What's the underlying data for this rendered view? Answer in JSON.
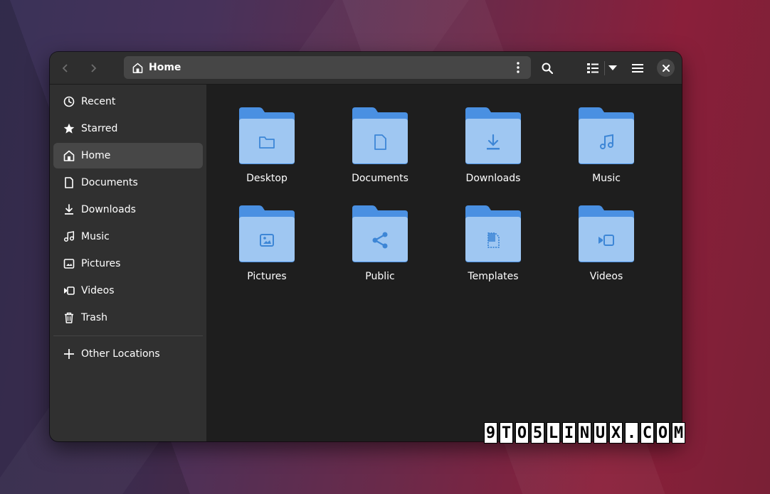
{
  "header": {
    "back_icon": "go-back-icon",
    "forward_icon": "go-forward-icon",
    "path_label": "Home",
    "path_icon": "home-icon",
    "menu_icon": "vertical-dots-icon",
    "search_icon": "search-icon",
    "view_icon": "list-view-icon",
    "view_dropdown_icon": "triangle-down-icon",
    "main_menu_icon": "hamburger-icon",
    "close_icon": "close-icon"
  },
  "sidebar": {
    "items": [
      {
        "label": "Recent",
        "icon": "clock-icon",
        "active": false
      },
      {
        "label": "Starred",
        "icon": "star-icon",
        "active": false
      },
      {
        "label": "Home",
        "icon": "home-icon",
        "active": true
      },
      {
        "label": "Documents",
        "icon": "document-icon",
        "active": false
      },
      {
        "label": "Downloads",
        "icon": "download-icon",
        "active": false
      },
      {
        "label": "Music",
        "icon": "music-icon",
        "active": false
      },
      {
        "label": "Pictures",
        "icon": "picture-icon",
        "active": false
      },
      {
        "label": "Videos",
        "icon": "video-icon",
        "active": false
      },
      {
        "label": "Trash",
        "icon": "trash-icon",
        "active": false
      }
    ],
    "other": {
      "label": "Other Locations",
      "icon": "plus-icon"
    }
  },
  "folders": [
    {
      "name": "Desktop",
      "icon": "folder-icon"
    },
    {
      "name": "Documents",
      "icon": "document-icon"
    },
    {
      "name": "Downloads",
      "icon": "download-icon"
    },
    {
      "name": "Music",
      "icon": "music-icon"
    },
    {
      "name": "Pictures",
      "icon": "picture-icon"
    },
    {
      "name": "Public",
      "icon": "share-icon"
    },
    {
      "name": "Templates",
      "icon": "template-icon"
    },
    {
      "name": "Videos",
      "icon": "video-icon"
    }
  ],
  "watermark": [
    "9",
    "T",
    "O",
    "5",
    "L",
    "I",
    "N",
    "U",
    "X",
    ".",
    "C",
    "O",
    "M"
  ],
  "colors": {
    "folder_back": "#4a90e2",
    "folder_front": "#9fc7f2",
    "folder_glyph": "#3d86d6"
  }
}
